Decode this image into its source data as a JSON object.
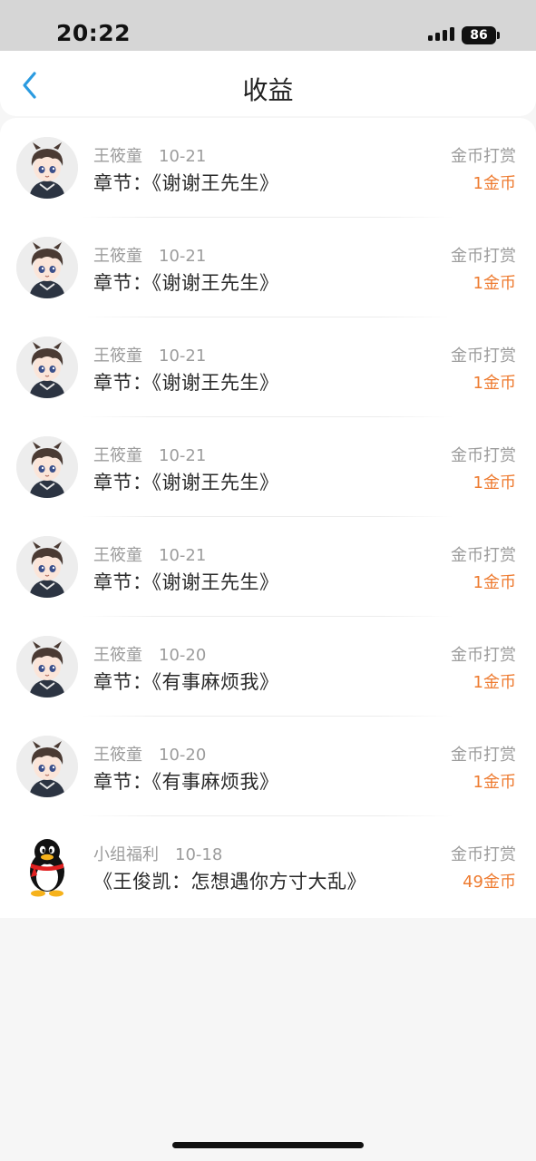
{
  "status_bar": {
    "time": "20:22",
    "battery": "86"
  },
  "header": {
    "title": "收益"
  },
  "rows": [
    {
      "avatar": "anime-boy-avatar",
      "user": "王筱童",
      "date": "10-21",
      "title": "章节：《谢谢王先生》",
      "type": "金币打赏",
      "amount": "1金币"
    },
    {
      "avatar": "anime-boy-avatar",
      "user": "王筱童",
      "date": "10-21",
      "title": "章节：《谢谢王先生》",
      "type": "金币打赏",
      "amount": "1金币"
    },
    {
      "avatar": "anime-boy-avatar",
      "user": "王筱童",
      "date": "10-21",
      "title": "章节：《谢谢王先生》",
      "type": "金币打赏",
      "amount": "1金币"
    },
    {
      "avatar": "anime-boy-avatar",
      "user": "王筱童",
      "date": "10-21",
      "title": "章节：《谢谢王先生》",
      "type": "金币打赏",
      "amount": "1金币"
    },
    {
      "avatar": "anime-boy-avatar",
      "user": "王筱童",
      "date": "10-21",
      "title": "章节：《谢谢王先生》",
      "type": "金币打赏",
      "amount": "1金币"
    },
    {
      "avatar": "anime-boy-avatar",
      "user": "王筱童",
      "date": "10-20",
      "title": "章节：《有事麻烦我》",
      "type": "金币打赏",
      "amount": "1金币"
    },
    {
      "avatar": "anime-boy-avatar",
      "user": "王筱童",
      "date": "10-20",
      "title": "章节：《有事麻烦我》",
      "type": "金币打赏",
      "amount": "1金币"
    },
    {
      "avatar": "qq-penguin-avatar",
      "user": "小组福利",
      "date": "10-18",
      "title": "《王俊凯：怎想遇你方寸大乱》",
      "type": "金币打赏",
      "amount": "49金币"
    }
  ],
  "colors": {
    "accent": "#ee7b30",
    "back": "#2b9be0",
    "muted": "#9c9c9c",
    "text": "#2a2a2a"
  }
}
